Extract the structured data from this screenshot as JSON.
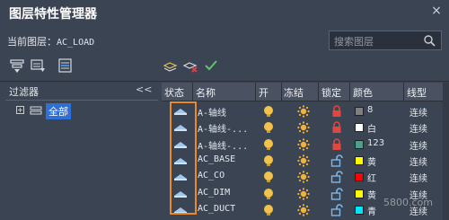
{
  "window": {
    "title": "图层特性管理器",
    "close_glyph": "×"
  },
  "current_layer": {
    "label": "当前图层：",
    "value": "AC_LOAD"
  },
  "search": {
    "placeholder": "搜索图层"
  },
  "filters": {
    "title": "过滤器",
    "collapse_glyph": "<<",
    "expand_glyph": "+",
    "all_label": "全部"
  },
  "columns": {
    "status": "状态",
    "name": "名称",
    "on": "开",
    "freeze": "冻结",
    "lock": "锁定",
    "color": "颜色",
    "linetype": "线型"
  },
  "layers": [
    {
      "name": "A-轴线",
      "locked": true,
      "color_name": "8",
      "color_hex": "#808080",
      "linetype": "连续",
      "status": "layer-status-icon"
    },
    {
      "name": "A-轴线-...",
      "locked": true,
      "color_name": "白",
      "color_hex": "#ffffff",
      "linetype": "连续",
      "status": "layer-status-icon"
    },
    {
      "name": "A-轴线-...",
      "locked": true,
      "color_name": "123",
      "color_hex": "#4aa088",
      "linetype": "连续",
      "status": "layer-status-icon"
    },
    {
      "name": "AC_BASE",
      "locked": false,
      "color_name": "黄",
      "color_hex": "#ffff00",
      "linetype": "连续",
      "status": "layer-status-icon"
    },
    {
      "name": "AC_CO",
      "locked": false,
      "color_name": "红",
      "color_hex": "#ff0000",
      "linetype": "连续",
      "status": "layer-status-icon"
    },
    {
      "name": "AC_DIM",
      "locked": false,
      "color_name": "黄",
      "color_hex": "#ffff00",
      "linetype": "连续",
      "status": "layer-status-icon"
    },
    {
      "name": "AC_DUCT",
      "locked": false,
      "color_name": "青",
      "color_hex": "#00e5ff",
      "linetype": "连续",
      "status": "layer-status-icon"
    }
  ],
  "watermark": "5800.com"
}
